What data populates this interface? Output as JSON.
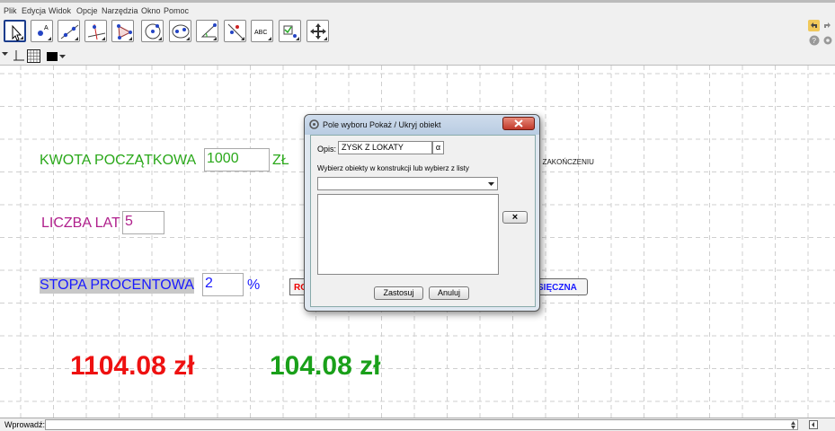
{
  "menu": {
    "items": [
      "Plik",
      "Edycja",
      "Widok",
      "Opcje",
      "Narzędzia",
      "Okno",
      "Pomoc"
    ]
  },
  "toolbar": {
    "tools": [
      {
        "name": "move-tool",
        "icon": "arrow-cursor-icon",
        "selected": true
      },
      {
        "name": "point-tool",
        "icon": "point-icon"
      },
      {
        "name": "line-tool",
        "icon": "line-through-points-icon"
      },
      {
        "name": "perpendicular-tool",
        "icon": "perpendicular-line-icon"
      },
      {
        "name": "polygon-tool",
        "icon": "polygon-icon"
      },
      {
        "name": "circle-tool",
        "icon": "circle-center-point-icon"
      },
      {
        "name": "conic-tool",
        "icon": "ellipse-icon"
      },
      {
        "name": "angle-tool",
        "icon": "angle-icon"
      },
      {
        "name": "reflect-tool",
        "icon": "reflect-line-icon"
      },
      {
        "name": "text-tool",
        "icon": "text-abc-icon",
        "text": "ABC"
      },
      {
        "name": "checkbox-tool",
        "icon": "checkbox-icon"
      },
      {
        "name": "move-view-tool",
        "icon": "move-graphics-view-icon"
      }
    ]
  },
  "canvas": {
    "kwota_label": "KWOTA POCZĄTKOWA",
    "kwota_value": "1000",
    "kwota_unit": "ZŁ",
    "lata_label": "LICZBA LAT",
    "lata_value": "5",
    "stopa_label": "STOPA PROCENTOWA",
    "stopa_value": "2",
    "stopa_unit": "%",
    "partial_right_text": "EJ ZAKOŃCZENIU",
    "partial_button_left": "RO",
    "partial_button_right": "SIĘCZNA",
    "result_total": "1104.08 zł",
    "result_profit": "104.08 zł"
  },
  "colors": {
    "kwota": "#2aa81a",
    "lata": "#b0208c",
    "stopa": "#1a1aff",
    "result_total": "#ee1111",
    "result_profit": "#1aa01a"
  },
  "dialog": {
    "title": "Pole wyboru Pokaż / Ukryj obiekt",
    "opis_label": "Opis:",
    "opis_value": "ZYSK Z LOKATY",
    "alpha_button": "α",
    "select_label": "Wybierz obiekty w konstrukcji lub wybierz z listy",
    "remove_button": "×",
    "apply_button": "Zastosuj",
    "cancel_button": "Anuluj"
  },
  "inputbar": {
    "label": "Wprowadź:"
  }
}
